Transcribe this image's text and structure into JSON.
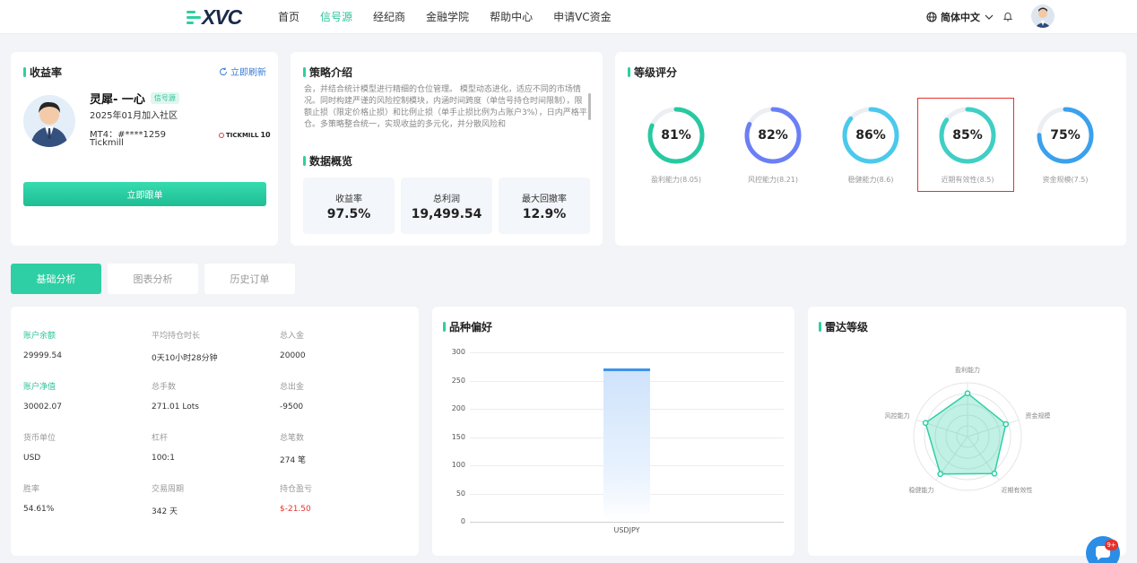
{
  "nav": {
    "logo": "XVC",
    "links": [
      "首页",
      "信号源",
      "经纪商",
      "金融学院",
      "帮助中心",
      "申请VC资金"
    ],
    "active_index": 1,
    "language": "简体中文"
  },
  "profit_card": {
    "title": "收益率",
    "refresh_label": "立即刷新",
    "name": "灵犀- 一心",
    "badge": "信号源",
    "joined": "2025年01月加入社区",
    "mt4": "MT4：#****1259",
    "broker": "Tickmill",
    "broker_logo_text": "TICKMILL",
    "broker_logo_badge": "10",
    "follow_button": "立即跟单"
  },
  "strategy_card": {
    "title": "策略介绍",
    "text": "会，并结合统计模型进行精细的仓位管理。 模型动态进化，适应不同的市场情况。同时构建严谨的风险控制模块，内涵时间跨度（单信号持仓时间限制），限额止损（限定价格止损）和比例止损（单手止损比例为占账户3%），日内严格平仓。多策略整合统一，实现收益的多元化，并分散风险和",
    "overview_title": "数据概览",
    "stats": [
      {
        "label": "收益率",
        "value": "97.5%"
      },
      {
        "label": "总利润",
        "value": "19,499.54"
      },
      {
        "label": "最大回撤率",
        "value": "12.9%"
      }
    ]
  },
  "rating_card": {
    "title": "等级评分",
    "gauges": [
      {
        "pct": "81%",
        "label": "盈利能力(8.05)",
        "value": 81,
        "color": "#27c9a0"
      },
      {
        "pct": "82%",
        "label": "风控能力(8.21)",
        "value": 82,
        "color": "#6b7ff5"
      },
      {
        "pct": "86%",
        "label": "稳健能力(8.6)",
        "value": 86,
        "color": "#4bc9ec"
      },
      {
        "pct": "85%",
        "label": "近期有效性(8.5)",
        "value": 85,
        "color": "#3fcfc4"
      },
      {
        "pct": "75%",
        "label": "资金规模(7.5)",
        "value": 75,
        "color": "#3aa1ee"
      }
    ],
    "highlighted_index": 3
  },
  "tabs": [
    "基础分析",
    "图表分析",
    "历史订单"
  ],
  "basic_analysis": {
    "items": [
      {
        "key": "账户余额",
        "value": "29999.54",
        "highlight": true
      },
      {
        "key": "平均持仓时长",
        "value": "0天10小时28分钟"
      },
      {
        "key": "总入金",
        "value": "20000"
      },
      {
        "key": "账户净值",
        "value": "30002.07",
        "highlight": true
      },
      {
        "key": "总手数",
        "value": "271.01 Lots"
      },
      {
        "key": "总出金",
        "value": "-9500"
      },
      {
        "key": "货币单位",
        "value": "USD"
      },
      {
        "key": "杠杆",
        "value": "100:1"
      },
      {
        "key": "总笔数",
        "value": "274 笔"
      },
      {
        "key": "胜率",
        "value": "54.61%"
      },
      {
        "key": "交易周期",
        "value": "342 天"
      },
      {
        "key": "持仓盈亏",
        "value": "$-21.50",
        "negative": true
      }
    ]
  },
  "preference_card": {
    "title": "品种偏好"
  },
  "chart_data": [
    {
      "type": "bar",
      "categories": [
        "USDJPY"
      ],
      "values": [
        271
      ],
      "ylim": [
        0,
        300
      ],
      "yticks": [
        0,
        50,
        100,
        150,
        200,
        250,
        300
      ],
      "grid": true
    },
    {
      "type": "radar",
      "axes": [
        "盈利能力",
        "资金规模",
        "近期有效性",
        "稳健能力",
        "风控能力"
      ],
      "values": [
        8.05,
        7.5,
        8.5,
        8.6,
        8.21
      ],
      "max": 10
    }
  ],
  "radar_card": {
    "title": "雷达等级"
  },
  "chat": {
    "badge": "9+"
  },
  "colors": {
    "accent": "#2ecf9f",
    "link": "#3a7bd5",
    "danger": "#e5322d"
  }
}
